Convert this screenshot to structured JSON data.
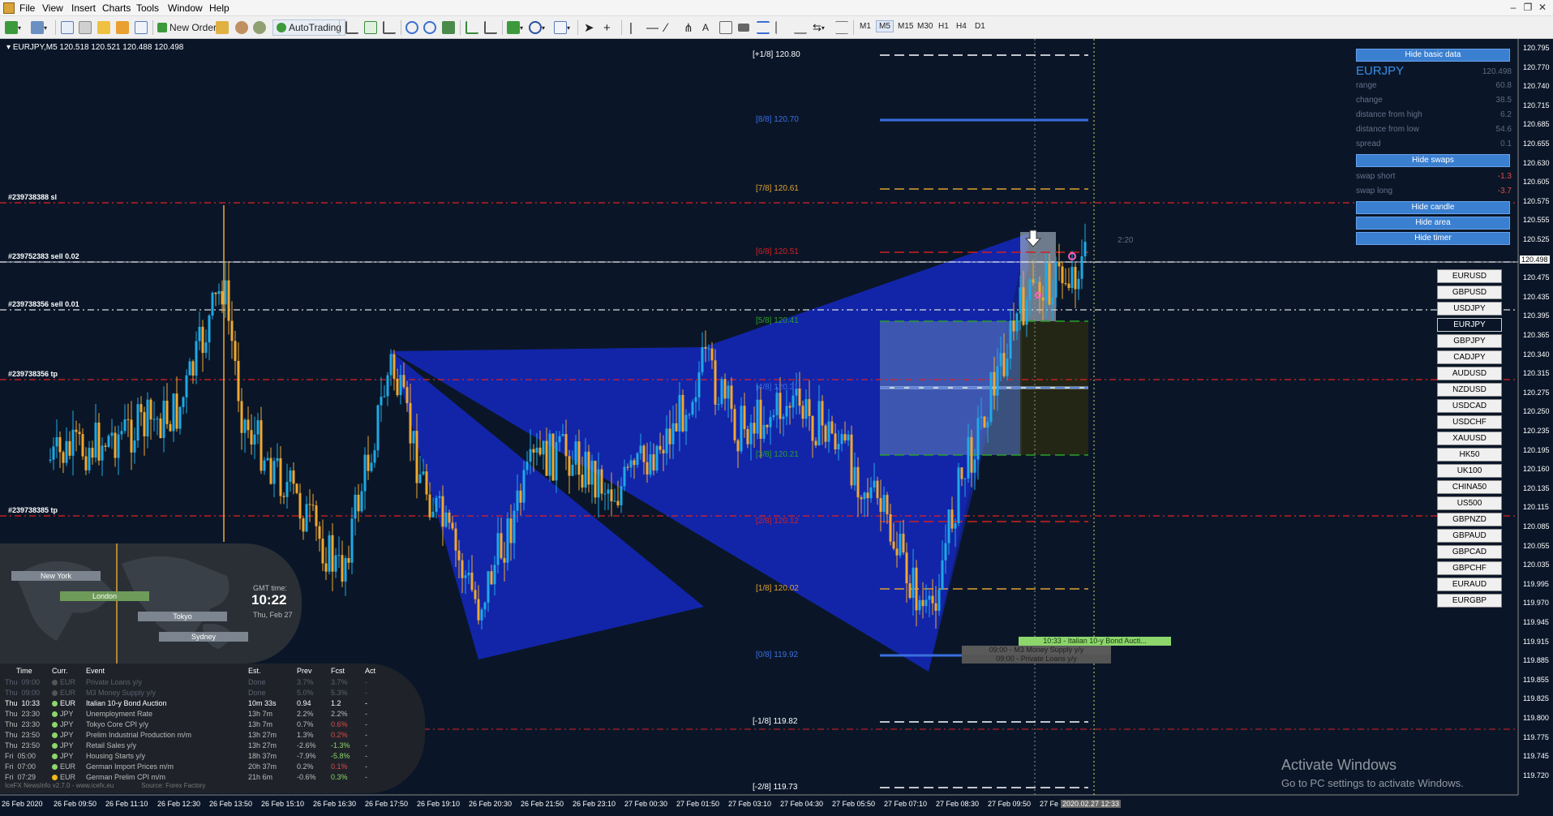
{
  "menu": [
    "File",
    "View",
    "Insert",
    "Charts",
    "Tools",
    "Window",
    "Help"
  ],
  "toolbar": {
    "new_order": "New Order",
    "autotrading": "AutoTrading",
    "timeframes": [
      "M1",
      "M5",
      "M15",
      "M30",
      "H1",
      "H4",
      "D1"
    ],
    "active_timeframe": "M5"
  },
  "chart": {
    "symbol_header": "EURJPY,M5  120.518 120.521 120.488 120.498",
    "current_price": "120.498",
    "current_time": "2020.02.27 12:33",
    "timer_text": "2:20",
    "price_ticks": [
      "120.795",
      "120.770",
      "120.740",
      "120.715",
      "120.685",
      "120.655",
      "120.630",
      "120.605",
      "120.575",
      "120.555",
      "120.525",
      "120.498",
      "120.475",
      "120.435",
      "120.395",
      "120.365",
      "120.340",
      "120.315",
      "120.275",
      "120.250",
      "120.235",
      "120.195",
      "120.160",
      "120.135",
      "120.115",
      "120.085",
      "120.055",
      "120.035",
      "119.995",
      "119.970",
      "119.945",
      "119.915",
      "119.885",
      "119.855",
      "119.825",
      "119.800",
      "119.775",
      "119.745",
      "119.720"
    ],
    "time_ticks": [
      "26 Feb 2020",
      "26 Feb 09:50",
      "26 Feb 11:10",
      "26 Feb 12:30",
      "26 Feb 13:50",
      "26 Feb 15:10",
      "26 Feb 16:30",
      "26 Feb 17:50",
      "26 Feb 19:10",
      "26 Feb 20:30",
      "26 Feb 21:50",
      "26 Feb 23:10",
      "27 Feb 00:30",
      "27 Feb 01:50",
      "27 Feb 03:10",
      "27 Feb 04:30",
      "27 Feb 05:50",
      "27 Feb 07:10",
      "27 Feb 08:30",
      "27 Feb 09:50",
      "27 Fe"
    ],
    "murrey_levels": [
      {
        "label": "[+1/8]",
        "price": "120.80",
        "color": "#ffffff"
      },
      {
        "label": "[8/8]",
        "price": "120.70",
        "color": "#3a6fe0"
      },
      {
        "label": "[7/8]",
        "price": "120.61",
        "color": "#e0a030"
      },
      {
        "label": "[6/8]",
        "price": "120.51",
        "color": "#d02020"
      },
      {
        "label": "[5/8]",
        "price": "120.41",
        "color": "#2aa02a"
      },
      {
        "label": "[4/8]",
        "price": "120.31",
        "color": "#3a6fe0"
      },
      {
        "label": "[3/8]",
        "price": "120.21",
        "color": "#2aa02a"
      },
      {
        "label": "[2/8]",
        "price": "120.12",
        "color": "#d02020"
      },
      {
        "label": "[1/8]",
        "price": "120.02",
        "color": "#e0a030"
      },
      {
        "label": "[0/8]",
        "price": "119.92",
        "color": "#3a6fe0"
      },
      {
        "label": "[-1/8]",
        "price": "119.82",
        "color": "#ffffff"
      },
      {
        "label": "[-2/8]",
        "price": "119.73",
        "color": "#ffffff"
      }
    ],
    "order_lines": [
      "#239738388 sl",
      "#239752383 sell 0.02",
      "#239738356 sell 0.01",
      "#239738356 tp",
      "#239738385 tp"
    ],
    "events": [
      {
        "text": "10:33 - Italian 10-y Bond Aucti..."
      },
      {
        "text": "09:00 - M3 Money Supply y/y"
      },
      {
        "text": "09:00 - Private Loans y/y"
      }
    ]
  },
  "info_panel": {
    "hide_basic": "Hide basic data",
    "symbol": "EURJPY",
    "symbol_price": "120.498",
    "rows": [
      {
        "label": "range",
        "value": "60.8"
      },
      {
        "label": "change",
        "value": "38.5"
      },
      {
        "label": "distance from high",
        "value": "6.2"
      },
      {
        "label": "distance from low",
        "value": "54.6"
      },
      {
        "label": "spread",
        "value": "0.1"
      }
    ],
    "hide_swaps": "Hide swaps",
    "swap_short_label": "swap short",
    "swap_short": "-1.3",
    "swap_long_label": "swap long",
    "swap_long": "-3.7",
    "hide_candle": "Hide candle",
    "hide_area": "Hide area",
    "hide_timer": "Hide timer"
  },
  "symbols": [
    "EURUSD",
    "GBPUSD",
    "USDJPY",
    "EURJPY",
    "GBPJPY",
    "CADJPY",
    "AUDUSD",
    "NZDUSD",
    "USDCAD",
    "USDCHF",
    "XAUUSD",
    "HK50",
    "UK100",
    "CHINA50",
    "US500",
    "GBPNZD",
    "GBPAUD",
    "GBPCAD",
    "GBPCHF",
    "EURAUD",
    "EURGBP"
  ],
  "active_symbol": "EURJPY",
  "sessions": {
    "cities": [
      "New York",
      "London",
      "Tokyo",
      "Sydney"
    ],
    "gmt_label": "GMT time:",
    "gmt_time": "10:22",
    "gmt_date": "Thu, Feb 27"
  },
  "news": {
    "headers": [
      "Time",
      "Curr.",
      "Event",
      "Est.",
      "Prev",
      "Fcst",
      "Act"
    ],
    "rows": [
      {
        "day": "Thu",
        "time": "09:00",
        "curr": "EUR",
        "event": "Private Loans y/y",
        "est": "Done",
        "prev": "3.7%",
        "fcst": "3.7%",
        "act": "-",
        "state": "past",
        "dot": "#555"
      },
      {
        "day": "Thu",
        "time": "09:00",
        "curr": "EUR",
        "event": "M3 Money Supply y/y",
        "est": "Done",
        "prev": "5.0%",
        "fcst": "5.3%",
        "act": "-",
        "state": "past",
        "dot": "#555"
      },
      {
        "day": "Thu",
        "time": "10:33",
        "curr": "EUR",
        "event": "Italian 10-y Bond Auction",
        "est": "10m 33s",
        "prev": "0.94",
        "fcst": "1.2",
        "act": "-",
        "state": "active",
        "dot": "#8cd66c"
      },
      {
        "day": "Thu",
        "time": "23:30",
        "curr": "JPY",
        "event": "Unemployment Rate",
        "est": "13h 7m",
        "prev": "2.2%",
        "fcst": "2.2%",
        "act": "-",
        "state": "",
        "dot": "#8cd66c"
      },
      {
        "day": "Thu",
        "time": "23:30",
        "curr": "JPY",
        "event": "Tokyo Core CPI y/y",
        "est": "13h 7m",
        "prev": "0.7%",
        "fcst": "0.6%",
        "act": "-",
        "state": "",
        "dot": "#8cd66c",
        "fcst_color": "#e04848"
      },
      {
        "day": "Thu",
        "time": "23:50",
        "curr": "JPY",
        "event": "Prelim Industrial Production m/m",
        "est": "13h 27m",
        "prev": "1.3%",
        "fcst": "0.2%",
        "act": "-",
        "state": "",
        "dot": "#8cd66c",
        "fcst_color": "#e04848"
      },
      {
        "day": "Thu",
        "time": "23:50",
        "curr": "JPY",
        "event": "Retail Sales y/y",
        "est": "13h 27m",
        "prev": "-2.6%",
        "fcst": "-1.3%",
        "act": "-",
        "state": "",
        "dot": "#8cd66c",
        "fcst_color": "#8cd66c"
      },
      {
        "day": "Fri",
        "time": "05:00",
        "curr": "JPY",
        "event": "Housing Starts y/y",
        "est": "18h 37m",
        "prev": "-7.9%",
        "fcst": "-5.8%",
        "act": "-",
        "state": "",
        "dot": "#8cd66c",
        "fcst_color": "#8cd66c"
      },
      {
        "day": "Fri",
        "time": "07:00",
        "curr": "EUR",
        "event": "German Import Prices m/m",
        "est": "20h 37m",
        "prev": "0.2%",
        "fcst": "0.1%",
        "act": "-",
        "state": "",
        "dot": "#8cd66c",
        "fcst_color": "#e04848"
      },
      {
        "day": "Fri",
        "time": "07:29",
        "curr": "EUR",
        "event": "German Prelim CPI m/m",
        "est": "21h 6m",
        "prev": "-0.6%",
        "fcst": "0.3%",
        "act": "-",
        "state": "",
        "dot": "#f2b818",
        "fcst_color": "#8cd66c"
      }
    ],
    "footer_left": "IceFX NewsInfo v2.7.0  -  www.icefx.eu",
    "footer_right": "Source: Forex Factory"
  },
  "watermark": {
    "title": "Activate Windows",
    "sub": "Go to PC settings to activate Windows."
  },
  "colors": {
    "chart_bg": "#0a1628",
    "bull_candle": "#1fa9e6",
    "bear_candle": "#f0a830",
    "pattern_fill": "#1020b0",
    "order_line": "#e02020"
  }
}
